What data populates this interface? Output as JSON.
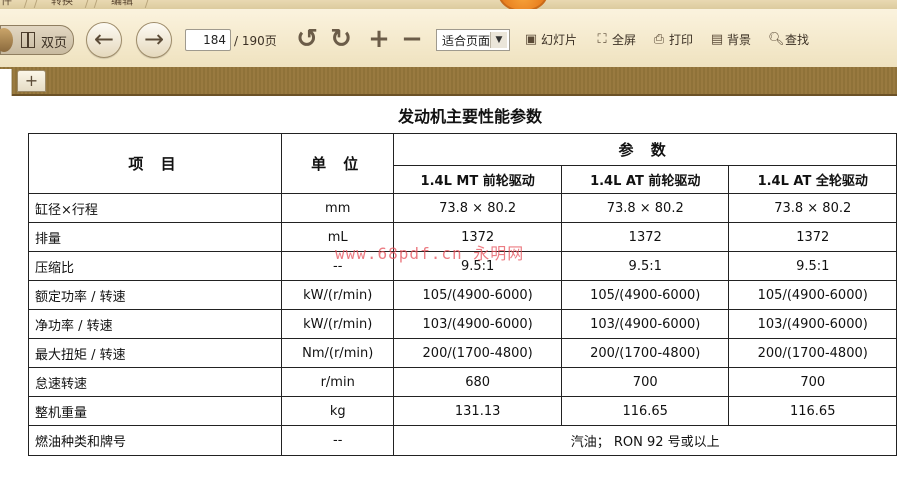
{
  "menubar": {
    "tabs": [
      "件",
      "转换",
      "编辑"
    ]
  },
  "toolbar": {
    "dual_page_label": "双页",
    "page_number": "184",
    "page_total": "/ 190页",
    "zoom_option": "适合页面",
    "slideshow_label": "幻灯片",
    "fullscreen_label": "全屏",
    "print_label": "打印",
    "background_label": "背景",
    "search_label": "查找"
  },
  "tabs": {
    "add_label": "+"
  },
  "document": {
    "title": "发动机主要性能参数",
    "table": {
      "header_item": "项 目",
      "header_unit": "单 位",
      "header_params": "参 数",
      "columns": [
        "1.4L MT 前轮驱动",
        "1.4L AT 前轮驱动",
        "1.4L AT 全轮驱动"
      ],
      "rows": [
        {
          "item": "缸径×行程",
          "unit": "mm",
          "values": [
            "73.8 × 80.2",
            "73.8 × 80.2",
            "73.8 × 80.2"
          ]
        },
        {
          "item": "排量",
          "unit": "mL",
          "values": [
            "1372",
            "1372",
            "1372"
          ]
        },
        {
          "item": "压缩比",
          "unit": "--",
          "values": [
            "9.5:1",
            "9.5:1",
            "9.5:1"
          ]
        },
        {
          "item": "额定功率 / 转速",
          "unit": "kW/(r/min)",
          "values": [
            "105/(4900-6000)",
            "105/(4900-6000)",
            "105/(4900-6000)"
          ]
        },
        {
          "item": "净功率 / 转速",
          "unit": "kW/(r/min)",
          "values": [
            "103/(4900-6000)",
            "103/(4900-6000)",
            "103/(4900-6000)"
          ]
        },
        {
          "item": "最大扭矩 / 转速",
          "unit": "Nm/(r/min)",
          "values": [
            "200/(1700-4800)",
            "200/(1700-4800)",
            "200/(1700-4800)"
          ]
        },
        {
          "item": "怠速转速",
          "unit": "r/min",
          "values": [
            "680",
            "700",
            "700"
          ]
        },
        {
          "item": "整机重量",
          "unit": "kg",
          "values": [
            "131.13",
            "116.65",
            "116.65"
          ]
        }
      ],
      "fuel_row": {
        "item": "燃油种类和牌号",
        "unit": "--",
        "value": "汽油； RON 92 号或以上"
      }
    },
    "watermark": "www.68pdf.cn 永明网"
  }
}
